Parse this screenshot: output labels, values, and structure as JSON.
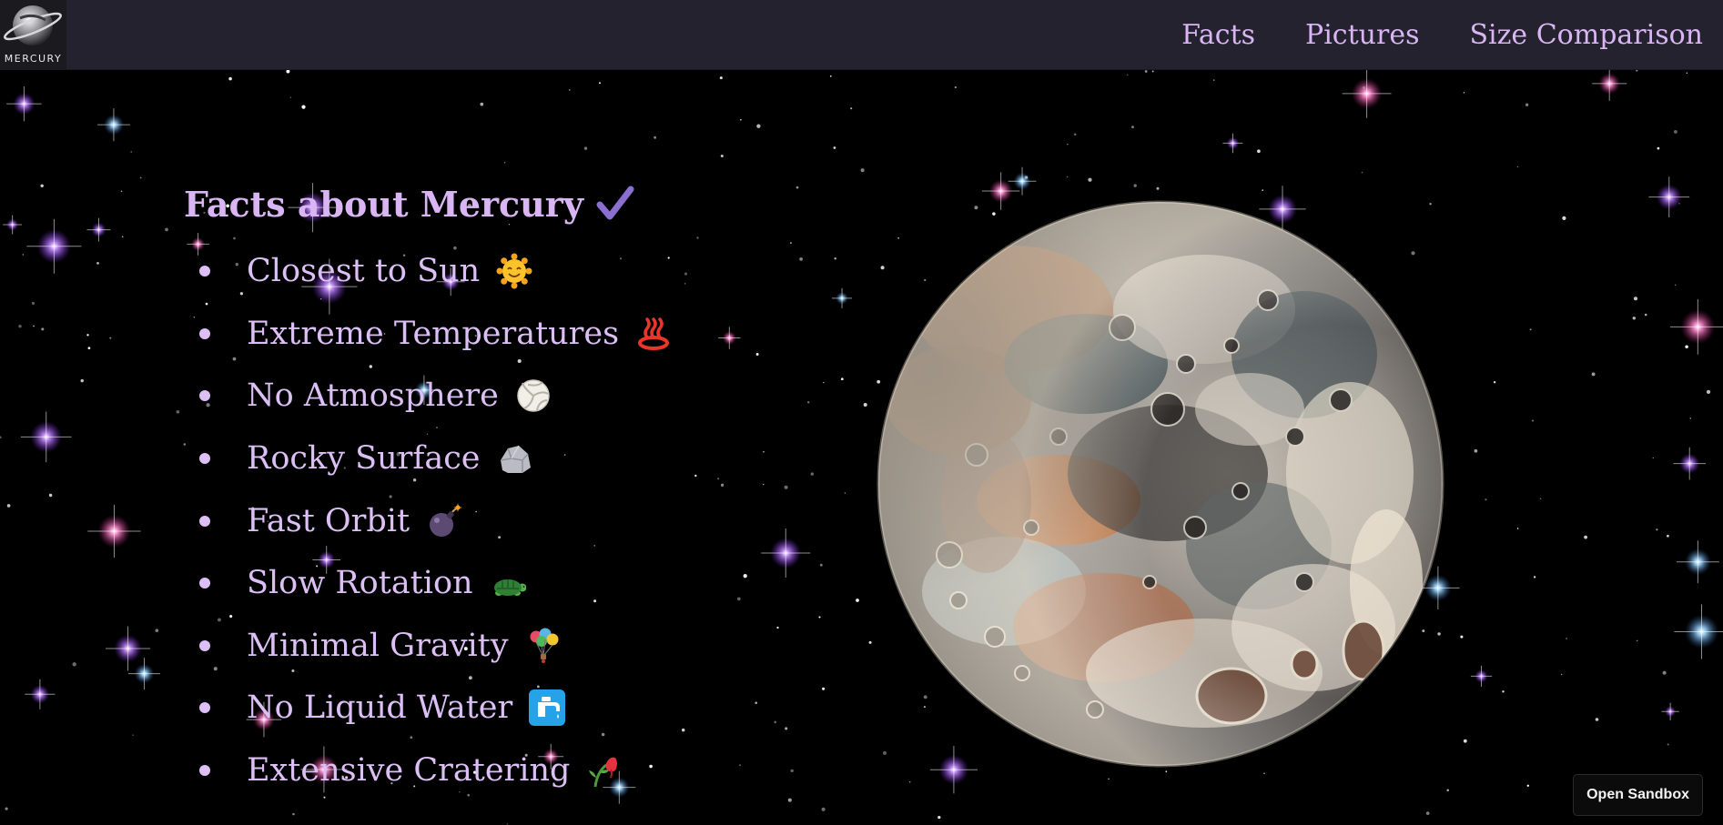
{
  "logo": {
    "text": "MERCURY",
    "icon": "planet-logo-icon"
  },
  "nav": {
    "links": [
      "Facts",
      "Pictures",
      "Size Comparison"
    ]
  },
  "facts": {
    "title": "Facts about Mercury",
    "title_icon": "check-icon",
    "items": [
      {
        "label": "Closest to Sun",
        "icon": "sun-face-icon"
      },
      {
        "label": "Extreme Temperatures",
        "icon": "hot-springs-icon"
      },
      {
        "label": "No Atmosphere",
        "icon": "volleyball-icon"
      },
      {
        "label": "Rocky Surface",
        "icon": "rock-icon"
      },
      {
        "label": "Fast Orbit",
        "icon": "bomb-icon"
      },
      {
        "label": "Slow Rotation",
        "icon": "turtle-icon"
      },
      {
        "label": "Minimal Gravity",
        "icon": "balloon-parachute-icon"
      },
      {
        "label": "No Liquid Water",
        "icon": "water-faucet-icon"
      },
      {
        "label": "Extensive Cratering",
        "icon": "wilted-flower-icon"
      }
    ]
  },
  "planet": {
    "icon": "mercury-planet-illustration"
  },
  "sandbox": {
    "label": "Open Sandbox"
  },
  "colors": {
    "accent": "#d9b6f3",
    "navbar": "#24222e",
    "background": "#000000"
  }
}
